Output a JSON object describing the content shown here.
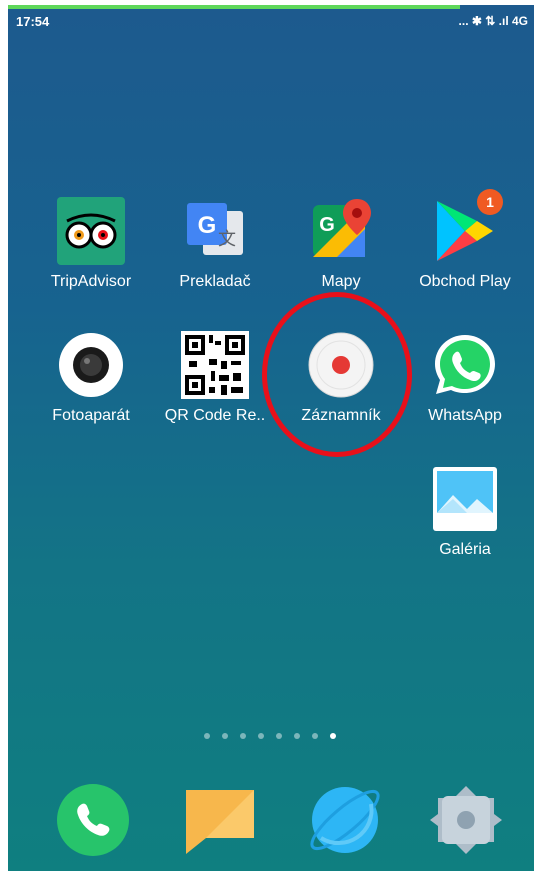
{
  "status_bar": {
    "time": "17:54",
    "indicators": "... ✱ ⇅ .ıl 4G",
    "network": "4G"
  },
  "apps": [
    {
      "label": "TripAdvisor",
      "icon": "tripadvisor-icon"
    },
    {
      "label": "Prekladač",
      "icon": "google-translate-icon"
    },
    {
      "label": "Mapy",
      "icon": "google-maps-icon"
    },
    {
      "label": "Obchod Play",
      "icon": "play-store-icon",
      "badge": "1"
    },
    {
      "label": "Fotoaparát",
      "icon": "camera-icon"
    },
    {
      "label": "QR Code Re..",
      "icon": "qr-code-icon"
    },
    {
      "label": "Záznamník",
      "icon": "recorder-icon"
    },
    {
      "label": "WhatsApp",
      "icon": "whatsapp-icon"
    },
    {
      "label": "Galéria",
      "icon": "gallery-icon"
    }
  ],
  "page_indicator": {
    "pages": 8,
    "current": 8
  },
  "dock": [
    {
      "icon": "phone-icon"
    },
    {
      "icon": "messages-icon"
    },
    {
      "icon": "browser-icon"
    },
    {
      "icon": "settings-icon"
    }
  ],
  "colors": {
    "highlight": "#e8101a",
    "badge": "#f05a22",
    "phone": "#27c46b",
    "messages": "#f7b74c",
    "browser": "#2db6f5"
  }
}
